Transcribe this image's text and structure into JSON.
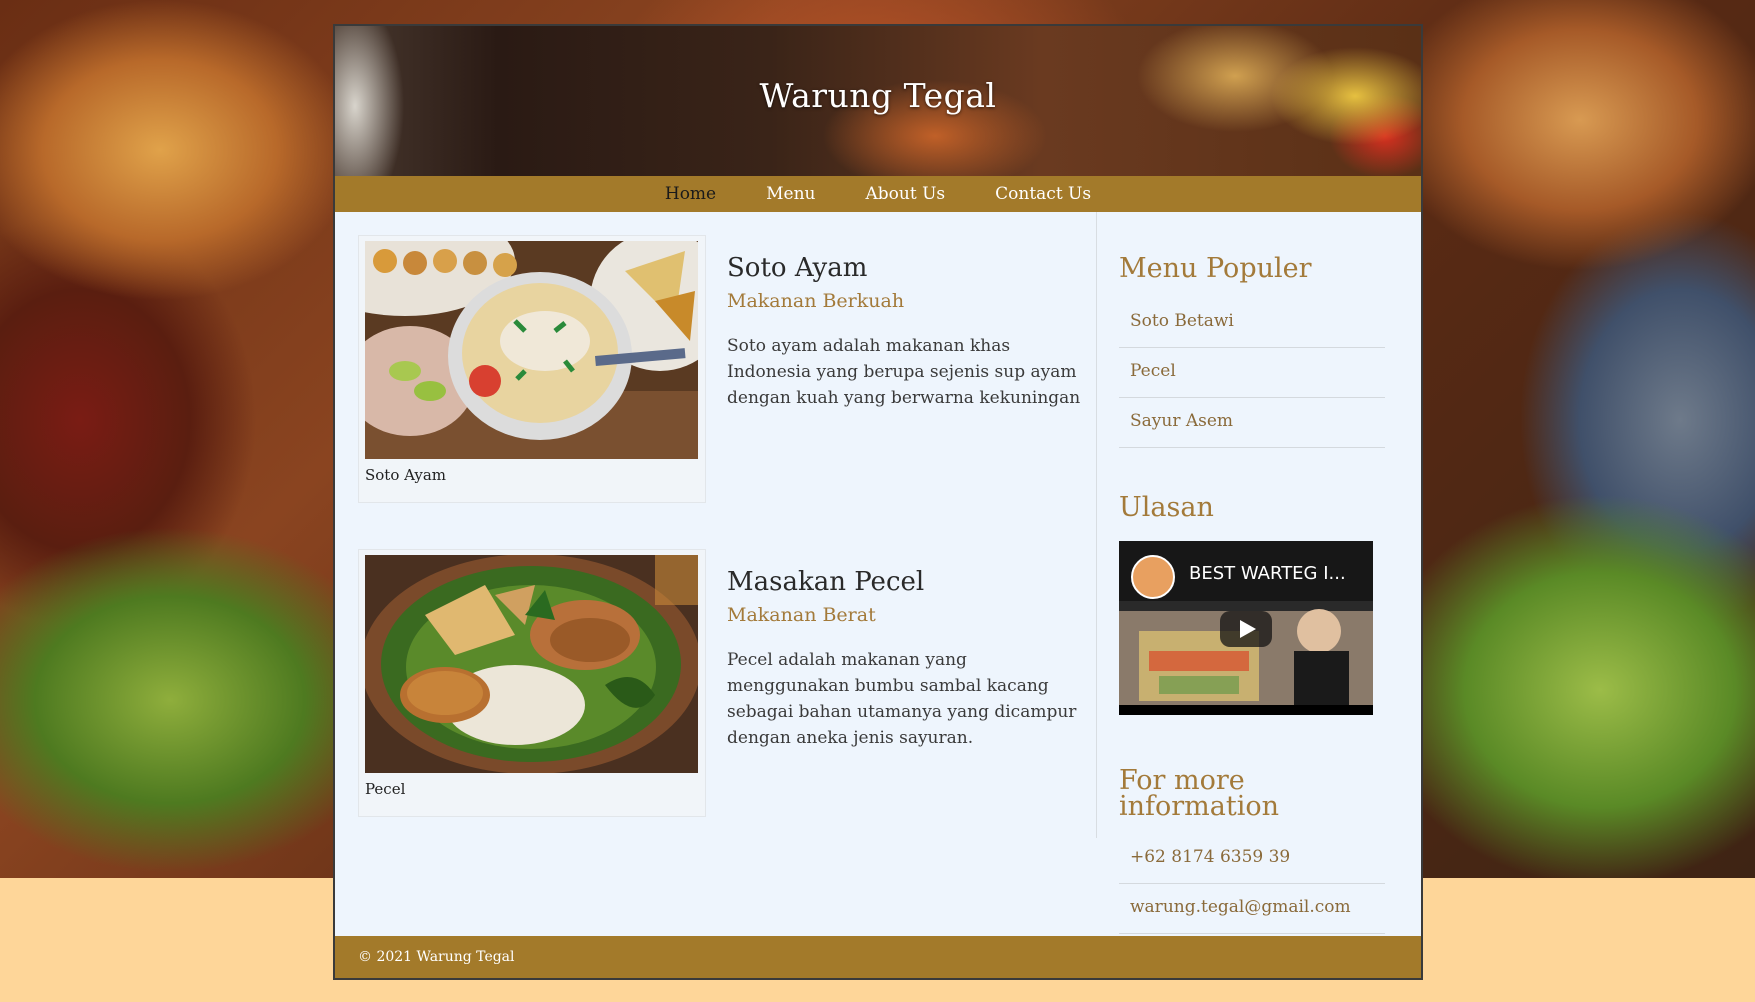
{
  "site": {
    "title": "Warung Tegal"
  },
  "nav": {
    "items": [
      "Home",
      "Menu",
      "About Us",
      "Contact Us"
    ],
    "active": "Home"
  },
  "articles": [
    {
      "caption": "Soto Ayam",
      "title": "Soto Ayam",
      "subtitle": "Makanan Berkuah",
      "body": "Soto ayam adalah makanan khas Indonesia yang berupa sejenis sup ayam dengan kuah yang berwarna kekuningan"
    },
    {
      "caption": "Pecel",
      "title": "Masakan Pecel",
      "subtitle": "Makanan Berat",
      "body": "Pecel adalah makanan yang menggunakan bumbu sambal kacang sebagai bahan utamanya yang dicampur dengan aneka jenis sayuran."
    }
  ],
  "sidebar": {
    "popular_heading": "Menu Populer",
    "popular_items": [
      "Soto Betawi",
      "Pecel",
      "Sayur Asem"
    ],
    "review_heading": "Ulasan",
    "video": {
      "title": "BEST WARTEG I..."
    },
    "info_heading": "For more information",
    "info_items": [
      "+62 8174 6359 39",
      "warung.tegal@gmail.com"
    ]
  },
  "footer": {
    "text": "© 2021 Warung Tegal"
  },
  "colors": {
    "accent": "#a37a2a",
    "heading": "#a37a3a",
    "page_bg": "#eef5fd",
    "body_bg": "#fed699"
  }
}
